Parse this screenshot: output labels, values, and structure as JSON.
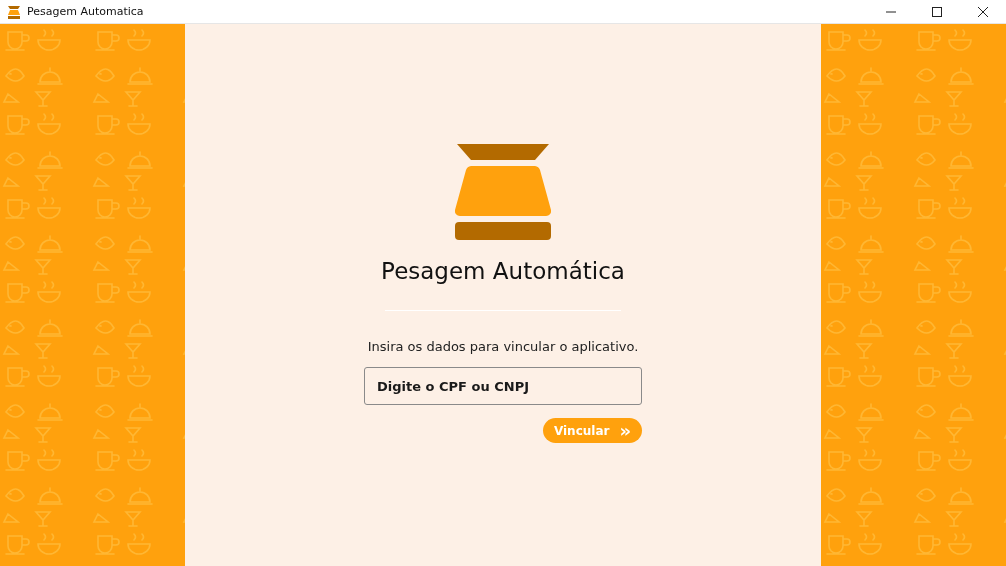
{
  "window": {
    "title": "Pesagem Automatica"
  },
  "main": {
    "heading": "Pesagem Automática",
    "instruction": "Insira os dados para vincular o aplicativo.",
    "document_field": {
      "placeholder": "Digite o CPF ou CNPJ"
    },
    "link_button": {
      "label": "Vincular",
      "icon": "»"
    }
  }
}
